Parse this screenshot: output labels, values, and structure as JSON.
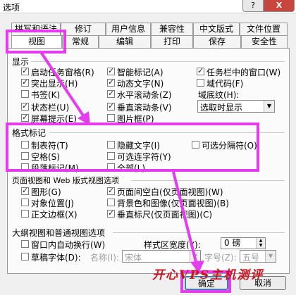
{
  "window": {
    "title": "选项",
    "help": "?",
    "close": "X"
  },
  "tabs_row1": [
    "拼写和语法",
    "修订",
    "用户信息",
    "兼容性",
    "中文版式",
    "文件位置"
  ],
  "tabs_row2": [
    "视图",
    "常规",
    "编辑",
    "打印",
    "保存",
    "安全性"
  ],
  "show": {
    "title": "显示",
    "items": [
      {
        "label": "启动任务窗格(R)",
        "checked": true
      },
      {
        "label": "智能标记(A)",
        "checked": true
      },
      {
        "label": "任务栏中的窗口(W)",
        "checked": true
      },
      {
        "label": "突出显示(H)",
        "checked": true
      },
      {
        "label": "动态文字(N)",
        "checked": true
      },
      {
        "label": "域代码(F)",
        "checked": false
      },
      {
        "label": "书签(K)",
        "checked": false
      },
      {
        "label": "水平滚动条(Z)",
        "checked": true
      },
      {
        "label": "状态栏(U)",
        "checked": true
      },
      {
        "label": "垂直滚动条(V)",
        "checked": true
      },
      {
        "label": "屏幕提示(E)",
        "checked": true
      },
      {
        "label": "图片框(P)",
        "checked": false
      }
    ],
    "shading_label": "域底纹(H):",
    "shading_value": "选取时显示"
  },
  "format_marks": {
    "title": "格式标记",
    "items": [
      {
        "label": "制表符(T)",
        "checked": false
      },
      {
        "label": "隐藏文字(I)",
        "checked": false
      },
      {
        "label": "可选分隔符(O)",
        "checked": false
      },
      {
        "label": "空格(S)",
        "checked": false
      },
      {
        "label": "可选连字符(Y)",
        "checked": false
      },
      {
        "label": "段落标记(M)",
        "checked": false
      },
      {
        "label": "全部(L)",
        "checked": false
      }
    ]
  },
  "page_view": {
    "title": "页面视图和 Web 版式视图选项",
    "items": [
      {
        "label": "图形(G)",
        "checked": true
      },
      {
        "label": "页面间空白(仅页面视图)(W)",
        "checked": true
      },
      {
        "label": "对象位置(J)",
        "checked": false
      },
      {
        "label": "背景色和图像(仅页面视图)(B)",
        "checked": false
      },
      {
        "label": "正文边框(X)",
        "checked": false
      },
      {
        "label": "垂直标尺(仅页面视图)(C)",
        "checked": true
      }
    ]
  },
  "outline": {
    "title": "大纲视图和普通视图选项",
    "wrap_label": "窗口内自动换行(W)",
    "draft_label": "草稿字体(D):",
    "name_label": "名称(I):",
    "name_value": "宋体",
    "size_label": "字号(Z):",
    "size_value": "五号",
    "style_width_label": "样式区宽度(Y):",
    "style_width_value": "0 磅"
  },
  "buttons": {
    "ok": "确定",
    "cancel": "取消"
  },
  "watermark": "开心VPS主机测评",
  "colors": {
    "highlight": "#e63cf0",
    "watermark": "#c8141c",
    "close": "#c9463d"
  }
}
